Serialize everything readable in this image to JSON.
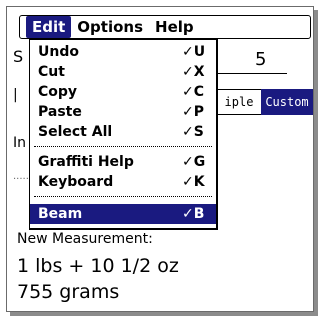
{
  "menubar": {
    "items": [
      "Edit",
      "Options",
      "Help"
    ]
  },
  "edit_menu": {
    "items": [
      {
        "label": "Undo",
        "shortcut": "✓U"
      },
      {
        "label": "Cut",
        "shortcut": "✓X"
      },
      {
        "label": "Copy",
        "shortcut": "✓C"
      },
      {
        "label": "Paste",
        "shortcut": "✓P"
      },
      {
        "label": "Select All",
        "shortcut": "✓S"
      },
      {
        "label": "Graffiti Help",
        "shortcut": "✓G"
      },
      {
        "label": "Keyboard",
        "shortcut": "✓K"
      },
      {
        "label": "Beam",
        "shortcut": "✓B"
      }
    ]
  },
  "background": {
    "s_label": "S",
    "value": "5",
    "in_label": "In",
    "seg_triple": "iple",
    "seg_custom": "Custom"
  },
  "result": {
    "label": "New Measurement:",
    "line1": "1 lbs + 10 1/2 oz",
    "line2": "755 grams"
  }
}
